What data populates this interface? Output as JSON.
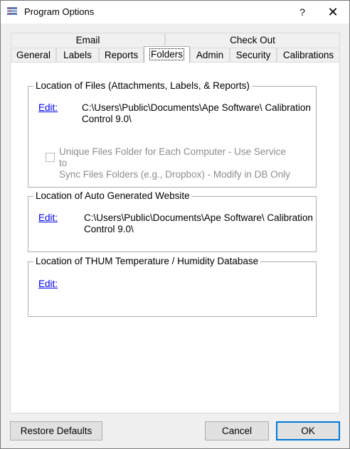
{
  "window": {
    "title": "Program Options",
    "help_label": "?",
    "close_label": "✕",
    "app_icon": "program-options-icon"
  },
  "tabs": {
    "row1": [
      {
        "label": "Email"
      },
      {
        "label": "Check Out"
      }
    ],
    "row2": [
      {
        "label": "General"
      },
      {
        "label": "Labels"
      },
      {
        "label": "Reports"
      },
      {
        "label": "Folders",
        "active": true
      },
      {
        "label": "Admin"
      },
      {
        "label": "Security"
      },
      {
        "label": "Calibrations"
      }
    ]
  },
  "groups": {
    "files": {
      "title": "Location of Files (Attachments, Labels, & Reports)",
      "edit_label": "Edit:",
      "path_line1": "C:\\Users\\Public\\Documents\\Ape Software\\ Calibration",
      "path_line2": "Control 9.0\\",
      "checkbox_line1": "Unique Files Folder for Each Computer - Use Service to",
      "checkbox_line2": "Sync Files Folders (e.g., Dropbox) - Modify in DB Only",
      "checkbox_checked": false
    },
    "website": {
      "title": "Location of Auto Generated Website",
      "edit_label": "Edit:",
      "path_line1": "C:\\Users\\Public\\Documents\\Ape Software\\ Calibration",
      "path_line2": "Control 9.0\\"
    },
    "thum": {
      "title": "Location of THUM Temperature / Humidity Database",
      "edit_label": "Edit:"
    }
  },
  "buttons": {
    "restore": "Restore Defaults",
    "cancel": "Cancel",
    "ok": "OK"
  },
  "colors": {
    "accent": "#0078d7",
    "link": "#0000ee"
  }
}
